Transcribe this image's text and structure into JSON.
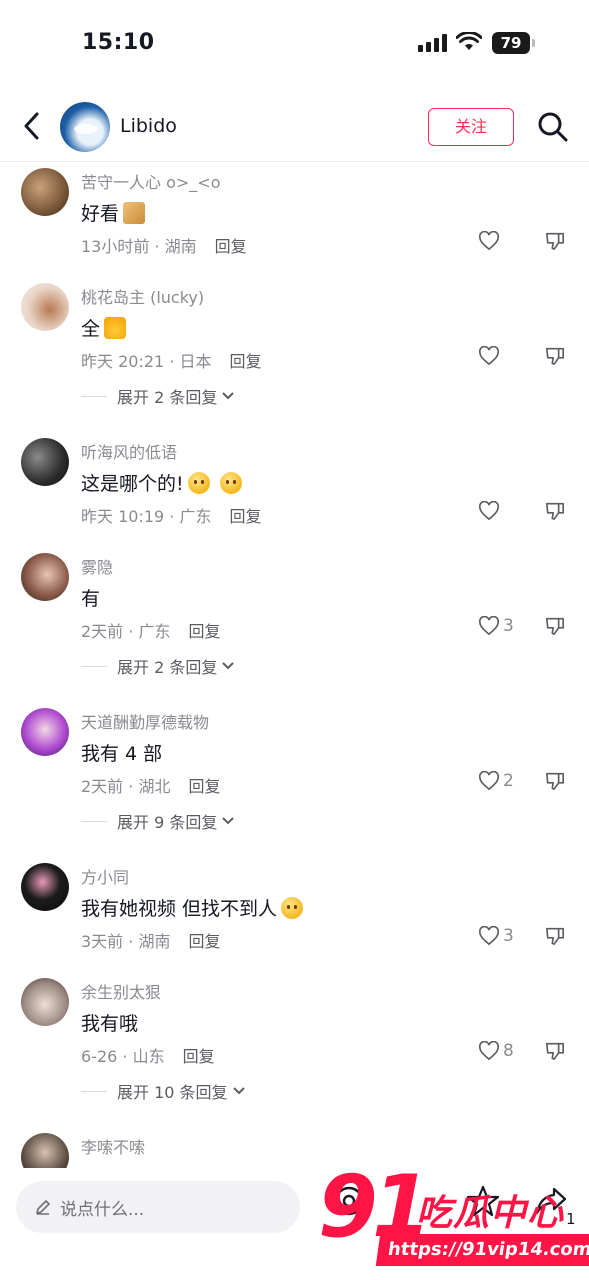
{
  "status": {
    "time": "15:10",
    "battery": "79"
  },
  "header": {
    "back_icon": "chevron-left-icon",
    "name": "Libido",
    "follow_label": "关注",
    "search_icon": "search-icon"
  },
  "comments": [
    {
      "user": "苦守一人心 o>_<o",
      "text": "好看",
      "emoji": "sticker",
      "meta": "13小时前 · 湖南",
      "reply": "回复",
      "likes": ""
    },
    {
      "user": "桃花岛主 (lucky)",
      "text": "全",
      "emoji": "thumbs-up",
      "meta": "昨天 20:21 · 日本",
      "reply": "回复",
      "likes": "",
      "expand": "展开 2 条回复"
    },
    {
      "user": "听海风的低语",
      "text": "这是哪个的!",
      "emoji": "thinking-face x2",
      "meta": "昨天 10:19 · 广东",
      "reply": "回复",
      "likes": ""
    },
    {
      "user": "雾隐",
      "text": "有",
      "meta": "2天前 · 广东",
      "reply": "回复",
      "likes": "3",
      "expand": "展开 2 条回复"
    },
    {
      "user": "天道酬勤厚德载物",
      "text": "我有 4 部",
      "meta": "2天前 · 湖北",
      "reply": "回复",
      "likes": "2",
      "expand": "展开 9 条回复"
    },
    {
      "user": "方小同",
      "text": "我有她视频 但找不到人",
      "emoji": "smile",
      "meta": "3天前 · 湖南",
      "reply": "回复",
      "likes": "3"
    },
    {
      "user": "余生别太狠",
      "text": "我有哦",
      "meta": "6-26 · 山东",
      "reply": "回复",
      "likes": "8",
      "expand": "展开 10 条回复"
    },
    {
      "user": "李嗦不嗦",
      "text": "",
      "meta": "",
      "reply": "",
      "likes": ""
    }
  ],
  "bottom": {
    "input_placeholder": "说点什么...",
    "count": "1"
  },
  "watermark": {
    "logo": "91",
    "name": "吃瓜中心",
    "url": "https://91vip14.com"
  },
  "colors": {
    "accent": "#fe2c55",
    "watermark": "#ff1446",
    "muted": "#8a8b91"
  }
}
